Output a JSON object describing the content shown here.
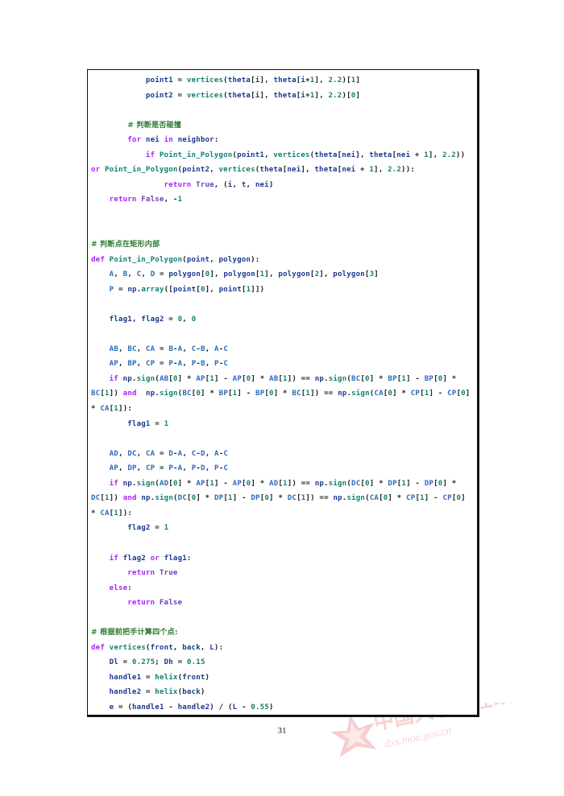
{
  "page": {
    "number": "31",
    "background_color": "#ffffff",
    "border_color": "#111111"
  },
  "watermark": {
    "chinese_text": "中国大学生在线",
    "url_text": "dxs.moe.gov.cn",
    "color": "#f6d3d3",
    "logo_name": "red-star-logo"
  },
  "colors": {
    "keyword": "#aa22ff",
    "builtin": "#6c40b6",
    "function": "#0e8272",
    "variable": "#1a3a8f",
    "variable_light": "#2b6cb8",
    "number": "#17806d",
    "comment": "#2f7d32",
    "operator": "#222222"
  },
  "code": {
    "language": "python",
    "lines": [
      {
        "id": 1,
        "text": "            point1 = vertices(theta[i], theta[i+1], 2.2)[1]"
      },
      {
        "id": 2,
        "text": "            point2 = vertices(theta[i], theta[i+1], 2.2)[0]"
      },
      {
        "id": 3,
        "text": ""
      },
      {
        "id": 4,
        "text": "        # 判断是否碰撞"
      },
      {
        "id": 5,
        "text": "        for nei in neighbor:"
      },
      {
        "id": 6,
        "text": "            if Point_in_Polygon(point1, vertices(theta[nei], theta[nei + 1], 2.2)) or Point_in_Polygon(point2, vertices(theta[nei], theta[nei + 1], 2.2)):"
      },
      {
        "id": 7,
        "text": "                return True, (i, t, nei)"
      },
      {
        "id": 8,
        "text": "    return False, -1"
      },
      {
        "id": 9,
        "text": ""
      },
      {
        "id": 10,
        "text": ""
      },
      {
        "id": 11,
        "text": "# 判断点在矩形内部"
      },
      {
        "id": 12,
        "text": "def Point_in_Polygon(point, polygon):"
      },
      {
        "id": 13,
        "text": "    A, B, C, D = polygon[0], polygon[1], polygon[2], polygon[3]"
      },
      {
        "id": 14,
        "text": "    P = np.array([point[0], point[1]])"
      },
      {
        "id": 15,
        "text": ""
      },
      {
        "id": 16,
        "text": "    flag1, flag2 = 0, 0"
      },
      {
        "id": 17,
        "text": ""
      },
      {
        "id": 18,
        "text": "    AB, BC, CA = B-A, C-B, A-C"
      },
      {
        "id": 19,
        "text": "    AP, BP, CP = P-A, P-B, P-C"
      },
      {
        "id": 20,
        "text": "    if np.sign(AB[0] * AP[1] - AP[0] * AB[1]) == np.sign(BC[0] * BP[1] - BP[0] * BC[1]) and  np.sign(BC[0] * BP[1] - BP[0] * BC[1]) == np.sign(CA[0] * CP[1] - CP[0] * CA[1]):"
      },
      {
        "id": 21,
        "text": "        flag1 = 1"
      },
      {
        "id": 22,
        "text": ""
      },
      {
        "id": 23,
        "text": "    AD, DC, CA = D-A, C-D, A-C"
      },
      {
        "id": 24,
        "text": "    AP, DP, CP = P-A, P-D, P-C"
      },
      {
        "id": 25,
        "text": "    if np.sign(AD[0] * AP[1] - AP[0] * AD[1]) == np.sign(DC[0] * DP[1] - DP[0] * DC[1]) and np.sign(DC[0] * DP[1] - DP[0] * DC[1]) == np.sign(CA[0] * CP[1] - CP[0] * CA[1]):"
      },
      {
        "id": 26,
        "text": "        flag2 = 1"
      },
      {
        "id": 27,
        "text": ""
      },
      {
        "id": 28,
        "text": "    if flag2 or flag1:"
      },
      {
        "id": 29,
        "text": "        return True"
      },
      {
        "id": 30,
        "text": "    else:"
      },
      {
        "id": 31,
        "text": "        return False"
      },
      {
        "id": 32,
        "text": ""
      },
      {
        "id": 33,
        "text": "# 根据前把手计算四个点:"
      },
      {
        "id": 34,
        "text": "def vertices(front, back, L):"
      },
      {
        "id": 35,
        "text": "    Dl = 0.275; Dh = 0.15"
      },
      {
        "id": 36,
        "text": "    handle1 = helix(front)"
      },
      {
        "id": 37,
        "text": "    handle2 = helix(back)"
      },
      {
        "id": 38,
        "text": "    e = (handle1 - handle2) / (L - 0.55)"
      }
    ]
  }
}
